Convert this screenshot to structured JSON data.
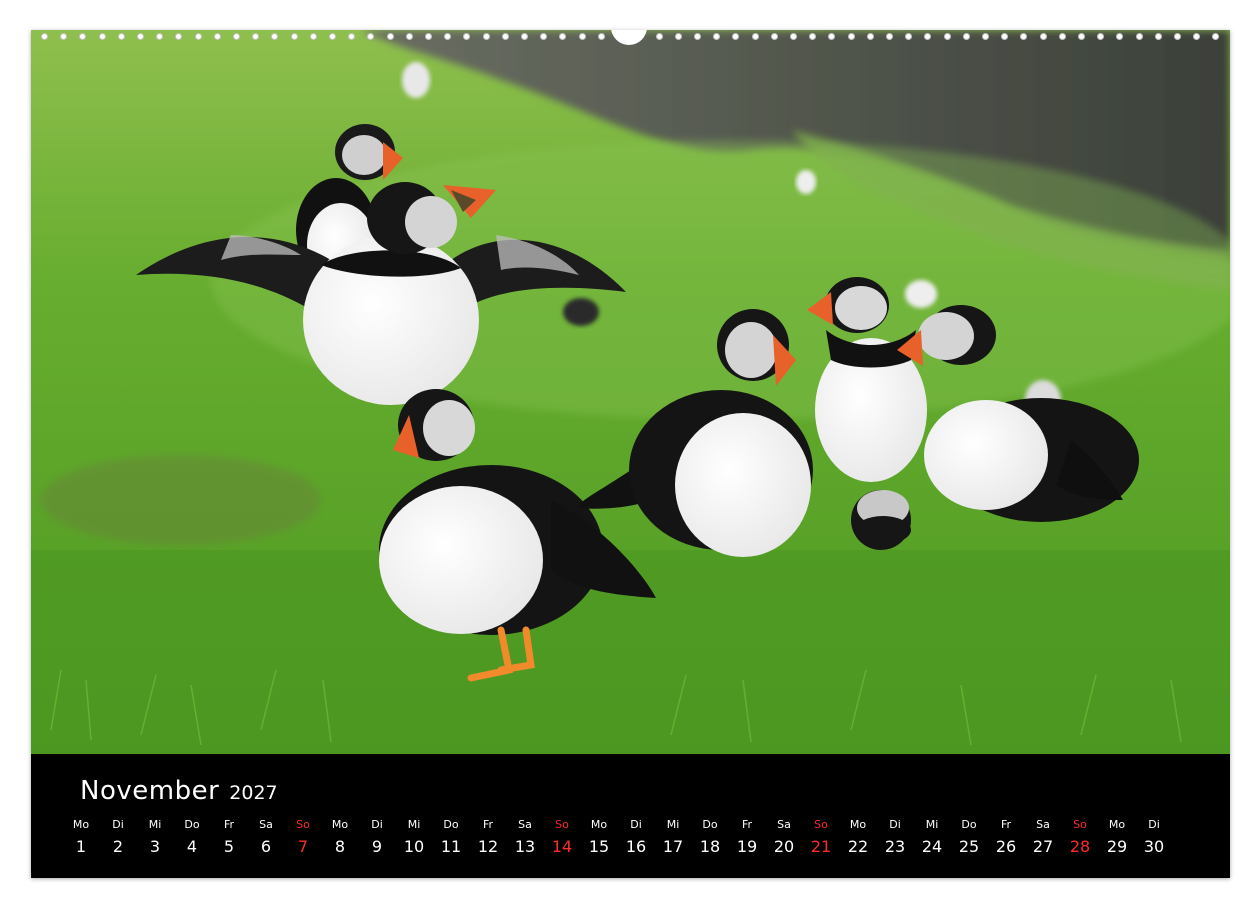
{
  "calendar": {
    "month": "November",
    "year": "2027",
    "sunday_color": "#ff2a2a",
    "days": [
      {
        "wd": "Mo",
        "n": "1"
      },
      {
        "wd": "Di",
        "n": "2"
      },
      {
        "wd": "Mi",
        "n": "3"
      },
      {
        "wd": "Do",
        "n": "4"
      },
      {
        "wd": "Fr",
        "n": "5"
      },
      {
        "wd": "Sa",
        "n": "6"
      },
      {
        "wd": "So",
        "n": "7",
        "sunday": true
      },
      {
        "wd": "Mo",
        "n": "8"
      },
      {
        "wd": "Di",
        "n": "9"
      },
      {
        "wd": "Mi",
        "n": "10"
      },
      {
        "wd": "Do",
        "n": "11"
      },
      {
        "wd": "Fr",
        "n": "12"
      },
      {
        "wd": "Sa",
        "n": "13"
      },
      {
        "wd": "So",
        "n": "14",
        "sunday": true
      },
      {
        "wd": "Mo",
        "n": "15"
      },
      {
        "wd": "Di",
        "n": "16"
      },
      {
        "wd": "Mi",
        "n": "17"
      },
      {
        "wd": "Do",
        "n": "18"
      },
      {
        "wd": "Fr",
        "n": "19"
      },
      {
        "wd": "Sa",
        "n": "20"
      },
      {
        "wd": "So",
        "n": "21",
        "sunday": true
      },
      {
        "wd": "Mo",
        "n": "22"
      },
      {
        "wd": "Di",
        "n": "23"
      },
      {
        "wd": "Mi",
        "n": "24"
      },
      {
        "wd": "Do",
        "n": "25"
      },
      {
        "wd": "Fr",
        "n": "26"
      },
      {
        "wd": "Sa",
        "n": "27"
      },
      {
        "wd": "So",
        "n": "28",
        "sunday": true
      },
      {
        "wd": "Mo",
        "n": "29"
      },
      {
        "wd": "Di",
        "n": "30"
      }
    ]
  },
  "photo": {
    "icon": "puffins-photo",
    "colors": {
      "grass": "#5fa82e",
      "grass_dark": "#3f7f1c",
      "rock": "#4a4f4a",
      "beak": "#e8602a"
    }
  }
}
